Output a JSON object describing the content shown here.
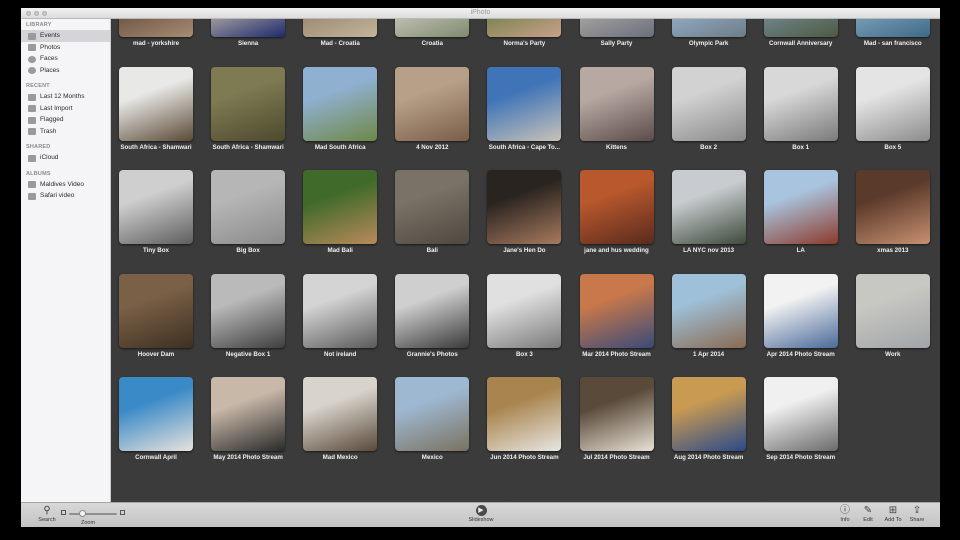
{
  "window": {
    "title": "iPhoto"
  },
  "sidebar": {
    "sections": [
      {
        "header": "LIBRARY",
        "items": [
          {
            "label": "Events",
            "icon": "events-icon",
            "selected": true
          },
          {
            "label": "Photos",
            "icon": "photos-icon"
          },
          {
            "label": "Faces",
            "icon": "faces-icon"
          },
          {
            "label": "Places",
            "icon": "places-icon"
          }
        ]
      },
      {
        "header": "RECENT",
        "items": [
          {
            "label": "Last 12 Months",
            "icon": "calendar-icon"
          },
          {
            "label": "Last Import",
            "icon": "import-icon"
          },
          {
            "label": "Flagged",
            "icon": "flag-icon"
          },
          {
            "label": "Trash",
            "icon": "trash-icon"
          }
        ]
      },
      {
        "header": "SHARED",
        "items": [
          {
            "label": "iCloud",
            "icon": "icloud-icon"
          }
        ]
      },
      {
        "header": "ALBUMS",
        "items": [
          {
            "label": "Maldives Video",
            "icon": "album-icon"
          },
          {
            "label": "Safari video",
            "icon": "album-icon"
          }
        ]
      }
    ]
  },
  "events": [
    {
      "title": "mad - yorkshire",
      "colors": [
        "#5a4436",
        "#a88c72"
      ]
    },
    {
      "title": "Sienna",
      "colors": [
        "#d8c8b0",
        "#1d2b6e"
      ]
    },
    {
      "title": "Mad - Croatia",
      "colors": [
        "#8c7a62",
        "#c4b59a"
      ]
    },
    {
      "title": "Croatia",
      "colors": [
        "#d9d5cc",
        "#7e8a6e"
      ]
    },
    {
      "title": "Norma's Party",
      "colors": [
        "#5e7a3a",
        "#c9a08a"
      ]
    },
    {
      "title": "Sally Party",
      "colors": [
        "#b9b5ac",
        "#6a6f7c"
      ]
    },
    {
      "title": "Olympic Park",
      "colors": [
        "#9eb9d8",
        "#6d7d88"
      ]
    },
    {
      "title": "Cornwall Anniversary",
      "colors": [
        "#7d95a6",
        "#4d5a42"
      ]
    },
    {
      "title": "Mad - san francisco",
      "colors": [
        "#8fb0c9",
        "#3e6a86"
      ]
    },
    {
      "title": "South Africa - Shamwari",
      "colors": [
        "#e8e8e6",
        "#5b4a36"
      ]
    },
    {
      "title": "South Africa - Shamwari",
      "colors": [
        "#7e7a52",
        "#4d4a2e"
      ]
    },
    {
      "title": "Mad South Africa",
      "colors": [
        "#8fb0d0",
        "#6e8848"
      ]
    },
    {
      "title": "4 Nov 2012",
      "colors": [
        "#b8a088",
        "#7a5e48"
      ]
    },
    {
      "title": "South Africa - Cape To...",
      "colors": [
        "#3f74b8",
        "#c8c2b8"
      ]
    },
    {
      "title": "Kittens",
      "colors": [
        "#b8a8a2",
        "#5a4c4a"
      ]
    },
    {
      "title": "Box 2",
      "colors": [
        "#d2d2d2",
        "#8a8a8a"
      ]
    },
    {
      "title": "Box 1",
      "colors": [
        "#d8d8d8",
        "#7a7a7a"
      ]
    },
    {
      "title": "Box 5",
      "colors": [
        "#e4e4e4",
        "#8c8c8c"
      ]
    },
    {
      "title": "Tiny Box",
      "colors": [
        "#cfcfcf",
        "#5e5e5e"
      ]
    },
    {
      "title": "Big Box",
      "colors": [
        "#b6b6b6",
        "#8a8a8a"
      ]
    },
    {
      "title": "Mad Bali",
      "colors": [
        "#3f6a2a",
        "#b98a5a"
      ]
    },
    {
      "title": "Bali",
      "colors": [
        "#7a7266",
        "#4e4840"
      ]
    },
    {
      "title": "Jane's Hen Do",
      "colors": [
        "#2a2420",
        "#a87a5e"
      ]
    },
    {
      "title": "jane and hus wedding",
      "colors": [
        "#b8582c",
        "#5a2a1e"
      ]
    },
    {
      "title": "LA NYC nov 2013",
      "colors": [
        "#c8ccd0",
        "#3e4a3a"
      ]
    },
    {
      "title": "LA",
      "colors": [
        "#a9c4de",
        "#8c3a2c"
      ]
    },
    {
      "title": "xmas 2013",
      "colors": [
        "#5a3a2a",
        "#c89070"
      ]
    },
    {
      "title": "Hoover Dam",
      "colors": [
        "#7a6046",
        "#3e3022"
      ]
    },
    {
      "title": "Negative Box 1",
      "colors": [
        "#bababa",
        "#3e3e3e"
      ]
    },
    {
      "title": "Not ireland",
      "colors": [
        "#d4d4d4",
        "#5a5a5a"
      ]
    },
    {
      "title": "Grannie's Photos",
      "colors": [
        "#cfcfcf",
        "#3a3a3a"
      ]
    },
    {
      "title": "Box 3",
      "colors": [
        "#e0e0e0",
        "#7a7a7a"
      ]
    },
    {
      "title": "Mar 2014 Photo Stream",
      "colors": [
        "#c8784a",
        "#3a4a7a"
      ]
    },
    {
      "title": "1 Apr 2014",
      "colors": [
        "#9ec0d8",
        "#8a6a52"
      ]
    },
    {
      "title": "Apr 2014 Photo Stream",
      "colors": [
        "#f2f2f2",
        "#4a6a9a"
      ]
    },
    {
      "title": "Work",
      "colors": [
        "#c8c8c2",
        "#a0a4a8"
      ]
    },
    {
      "title": "Cornwall April",
      "colors": [
        "#3a8ac8",
        "#e8e2dc"
      ]
    },
    {
      "title": "May 2014 Photo Stream",
      "colors": [
        "#c8b8a8",
        "#2a2a2a"
      ]
    },
    {
      "title": "Mad Mexico",
      "colors": [
        "#d8d4cc",
        "#5a4a3a"
      ]
    },
    {
      "title": "Mexico",
      "colors": [
        "#9eb8d2",
        "#7a7260"
      ]
    },
    {
      "title": "Jun 2014 Photo Stream",
      "colors": [
        "#a8844e",
        "#e8e6e2"
      ]
    },
    {
      "title": "Jul 2014 Photo Stream",
      "colors": [
        "#5a4a3a",
        "#e8e2d4"
      ]
    },
    {
      "title": "Aug 2014 Photo Stream",
      "colors": [
        "#c89a52",
        "#2a4a8a"
      ]
    },
    {
      "title": "Sep 2014 Photo Stream",
      "colors": [
        "#f0f0f0",
        "#6a6a6a"
      ]
    }
  ],
  "toolbar": {
    "left": [
      {
        "label": "Search",
        "icon": "search-icon",
        "glyph": "⚲"
      },
      {
        "label": "Zoom",
        "icon": "zoom-slider",
        "zoom_level": 0.3
      }
    ],
    "center": {
      "label": "Slideshow",
      "icon": "play-icon",
      "glyph": "▶"
    },
    "right": [
      {
        "label": "Info",
        "icon": "info-icon",
        "glyph": "ⓘ"
      },
      {
        "label": "Edit",
        "icon": "pencil-icon",
        "glyph": "✎"
      },
      {
        "label": "Add To",
        "icon": "add-icon",
        "glyph": "⊞"
      },
      {
        "label": "Share",
        "icon": "share-icon",
        "glyph": "⇪"
      }
    ]
  }
}
